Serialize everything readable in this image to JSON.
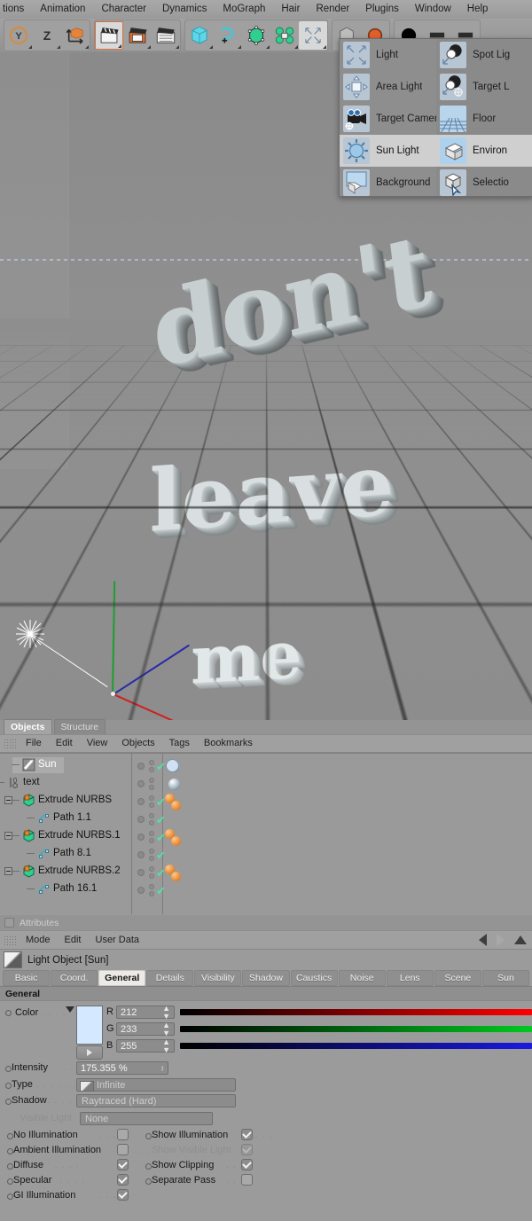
{
  "menubar": {
    "items": [
      {
        "label": "tions"
      },
      {
        "label": "Animation"
      },
      {
        "label": "Character"
      },
      {
        "label": "Dynamics"
      },
      {
        "label": "MoGraph"
      },
      {
        "label": "Hair"
      },
      {
        "label": "Render"
      },
      {
        "label": "Plugins"
      },
      {
        "label": "Window"
      },
      {
        "label": "Help"
      }
    ]
  },
  "toolbar": {
    "groups": [
      {
        "buttons": [
          {
            "name": "axis-y-icon",
            "selected": false
          },
          {
            "name": "z-axis-icon",
            "selected": false
          },
          {
            "name": "world-object-axis-icon",
            "selected": false
          }
        ]
      },
      {
        "buttons": [
          {
            "name": "render-view-icon",
            "selected": true
          },
          {
            "name": "render-region-icon",
            "selected": false
          },
          {
            "name": "render-settings-icon",
            "selected": false
          }
        ]
      },
      {
        "buttons": [
          {
            "name": "add-cube-icon",
            "selected": false
          },
          {
            "name": "add-spline-icon",
            "selected": false
          },
          {
            "name": "nurbs-icon",
            "selected": false
          },
          {
            "name": "array-icon",
            "selected": false
          },
          {
            "name": "add-light-icon",
            "selected": true
          }
        ]
      },
      {
        "buttons": [
          {
            "name": "deformer-icon",
            "selected": false
          },
          {
            "name": "environment-icon",
            "selected": false
          }
        ]
      },
      {
        "buttons": [
          {
            "name": "material-sphere-icon",
            "selected": false
          },
          {
            "name": "toolbar-extra-1-icon",
            "selected": false
          },
          {
            "name": "toolbar-extra-2-icon",
            "selected": false
          }
        ]
      }
    ]
  },
  "light_popup": {
    "left_column": [
      {
        "label": "Light",
        "icon": "light-icon",
        "highlighted": false
      },
      {
        "label": "Area Light",
        "icon": "area-light-icon",
        "highlighted": false
      },
      {
        "label": "Target Camera",
        "icon": "target-camera-icon",
        "highlighted": false
      },
      {
        "label": "Sun Light",
        "icon": "sun-light-icon",
        "highlighted": true
      },
      {
        "label": "Background",
        "icon": "background-icon",
        "highlighted": false
      }
    ],
    "right_column": [
      {
        "label": "Spot Lig",
        "icon": "spot-light-icon",
        "highlighted": false
      },
      {
        "label": "Target L",
        "icon": "target-light-icon",
        "highlighted": false
      },
      {
        "label": "Floor",
        "icon": "floor-icon",
        "highlighted": false
      },
      {
        "label": "Environ",
        "icon": "environment-icon",
        "highlighted": true
      },
      {
        "label": "Selectio",
        "icon": "selection-object-icon",
        "highlighted": false
      }
    ]
  },
  "viewport": {
    "text_objects": [
      {
        "text": "don't"
      },
      {
        "text": "leave"
      },
      {
        "text": "me"
      }
    ],
    "axes": [
      {
        "name": "y-axis",
        "color": "#1d9e2f"
      },
      {
        "name": "x-axis",
        "color": "#cf2020"
      },
      {
        "name": "z-axis",
        "color": "#2a2aa8"
      }
    ],
    "light_gizmo": {
      "name": "sun-light-gizmo",
      "color": "#ffffff"
    },
    "background_color": "#8e8e8e"
  },
  "object_manager": {
    "tabs": [
      {
        "label": "Objects",
        "active": true
      },
      {
        "label": "Structure",
        "active": false
      }
    ],
    "menu": [
      "File",
      "Edit",
      "View",
      "Objects",
      "Tags",
      "Bookmarks"
    ],
    "rows": [
      {
        "name": "Sun",
        "depth": 1,
        "icon": "light-object-icon",
        "selected": true,
        "expander": "",
        "visdots": true,
        "check": true,
        "tags": [
          "sun-tag"
        ]
      },
      {
        "name": "text",
        "depth": 0,
        "icon": "null-object-icon",
        "selected": false,
        "expander": "-",
        "visdots": true,
        "check": false,
        "tags": [
          "mograph-text-tag"
        ]
      },
      {
        "name": "Extrude NURBS",
        "depth": 1,
        "icon": "extrude-nurbs-icon",
        "selected": false,
        "expander": "-",
        "visdots": true,
        "check": true,
        "tags": [
          "material-tag",
          "material-tag"
        ]
      },
      {
        "name": "Path 1.1",
        "depth": 2,
        "icon": "spline-icon",
        "selected": false,
        "expander": "",
        "visdots": true,
        "check": true,
        "tags": []
      },
      {
        "name": "Extrude NURBS.1",
        "depth": 1,
        "icon": "extrude-nurbs-icon",
        "selected": false,
        "expander": "-",
        "visdots": true,
        "check": true,
        "tags": [
          "material-tag",
          "material-tag"
        ]
      },
      {
        "name": "Path 8.1",
        "depth": 2,
        "icon": "spline-icon",
        "selected": false,
        "expander": "",
        "visdots": true,
        "check": true,
        "tags": []
      },
      {
        "name": "Extrude NURBS.2",
        "depth": 1,
        "icon": "extrude-nurbs-icon",
        "selected": false,
        "expander": "-",
        "visdots": true,
        "check": true,
        "tags": [
          "material-tag",
          "material-tag"
        ]
      },
      {
        "name": "Path 16.1",
        "depth": 2,
        "icon": "spline-icon",
        "selected": false,
        "expander": "",
        "visdots": true,
        "check": true,
        "tags": []
      }
    ]
  },
  "attribute_manager": {
    "title": "Attributes",
    "menu": [
      "Mode",
      "Edit",
      "User Data"
    ],
    "object_header": "Light Object [Sun]",
    "tabs": [
      {
        "label": "Basic",
        "active": false
      },
      {
        "label": "Coord.",
        "active": false
      },
      {
        "label": "General",
        "active": true
      },
      {
        "label": "Details",
        "active": false
      },
      {
        "label": "Visibility",
        "active": false
      },
      {
        "label": "Shadow",
        "active": false
      },
      {
        "label": "Caustics",
        "active": false
      },
      {
        "label": "Noise",
        "active": false
      },
      {
        "label": "Lens",
        "active": false
      },
      {
        "label": "Scene",
        "active": false
      },
      {
        "label": "Sun",
        "active": false
      }
    ],
    "section_header": "General",
    "color": {
      "label": "Color",
      "swatch_hex": "#d4e9ff",
      "channels": [
        {
          "label": "R",
          "value": "212",
          "grad_hex": "#ff0000"
        },
        {
          "label": "G",
          "value": "233",
          "grad_hex": "#00c91f"
        },
        {
          "label": "B",
          "value": "255",
          "grad_hex": "#1a1ae0"
        }
      ]
    },
    "fields": [
      {
        "label": "Intensity",
        "value": "175.355 %",
        "type": "spinner"
      },
      {
        "label": "Type",
        "value": "Infinite",
        "type": "dropdown-icon"
      },
      {
        "label": "Shadow",
        "value": "Raytraced (Hard)",
        "type": "dropdown"
      },
      {
        "label": "Visible Light",
        "value": "None",
        "type": "dropdown",
        "dim": true
      }
    ],
    "checkboxes_left": [
      {
        "label": "No Illumination",
        "checked": false,
        "dim": false
      },
      {
        "label": "Ambient Illumination",
        "checked": false,
        "dim": false
      },
      {
        "label": "Diffuse",
        "checked": true,
        "dim": false
      },
      {
        "label": "Specular",
        "checked": true,
        "dim": false
      },
      {
        "label": "GI Illumination",
        "checked": true,
        "dim": false
      }
    ],
    "checkboxes_right": [
      {
        "label": "Show Illumination",
        "checked": true,
        "dim": false
      },
      {
        "label": "Show Visible Light",
        "checked": true,
        "dim": true
      },
      {
        "label": "Show Clipping",
        "checked": true,
        "dim": false
      },
      {
        "label": "Separate Pass",
        "checked": false,
        "dim": false
      }
    ]
  }
}
